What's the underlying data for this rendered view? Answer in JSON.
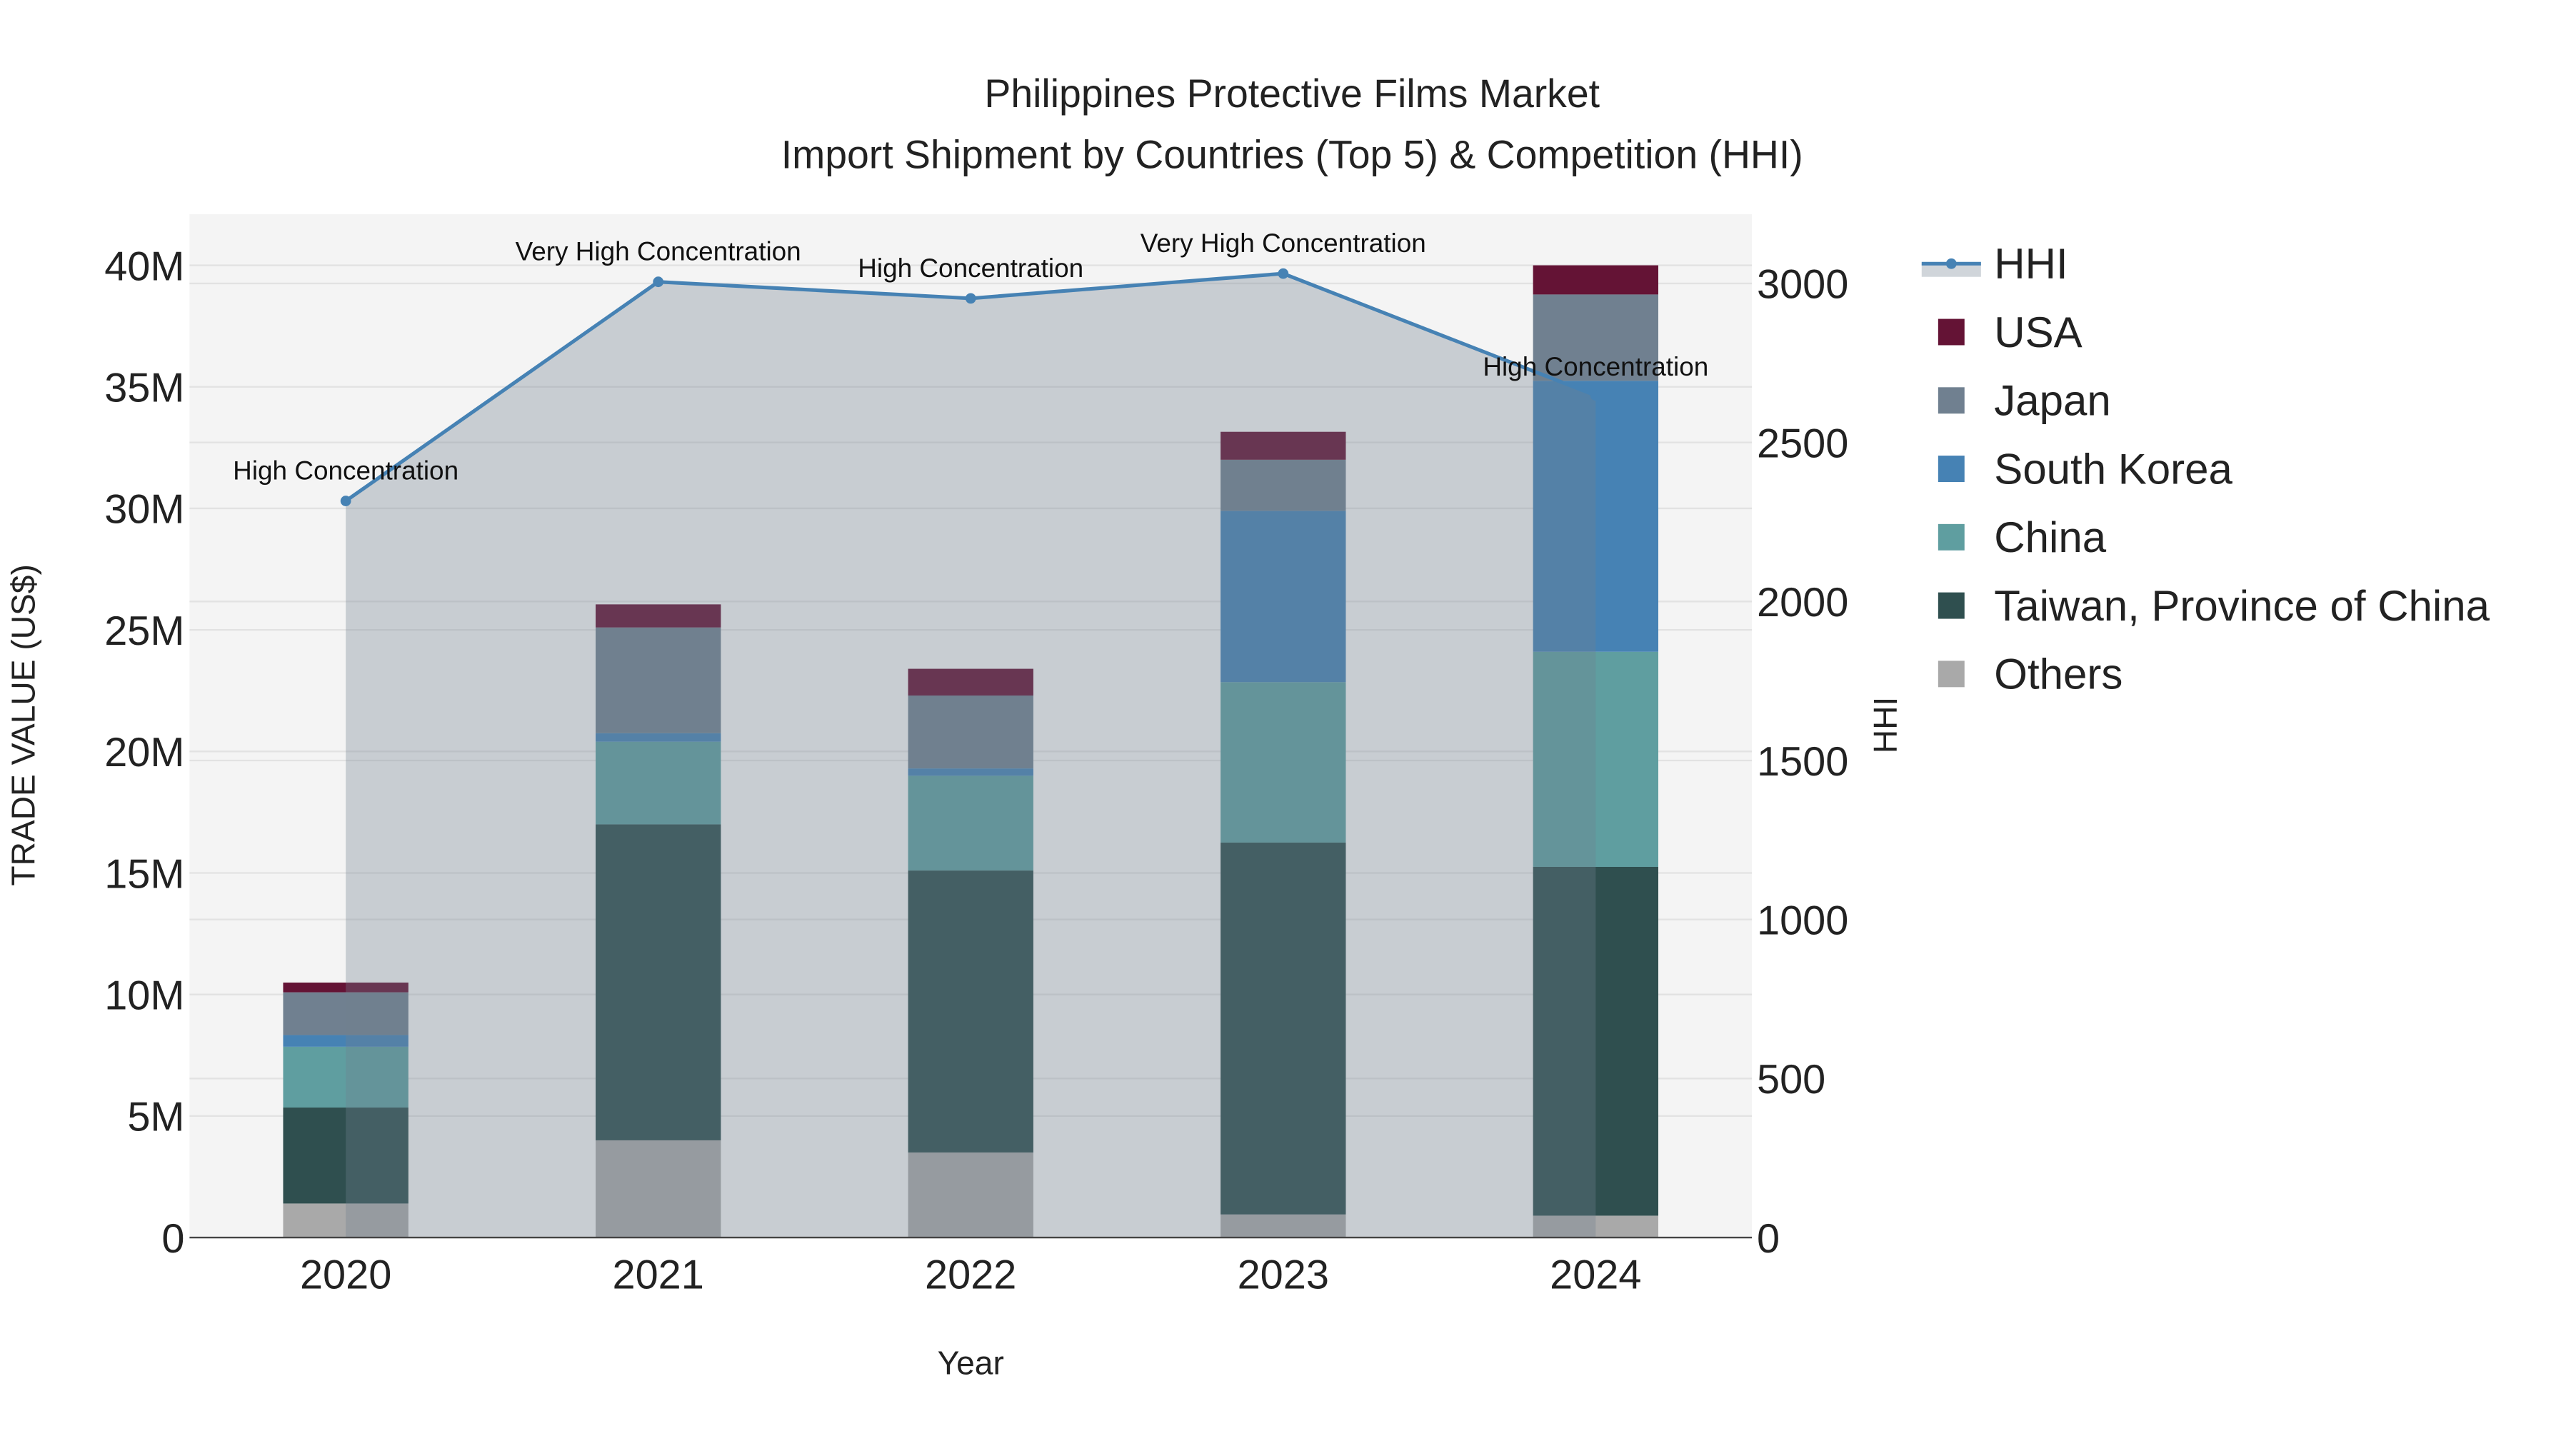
{
  "chart_data": {
    "type": "bar",
    "title": "Philippines Protective Films Market",
    "subtitle": "Import Shipment by Countries (Top 5) & Competition (HHI)",
    "xlabel": "Year",
    "ylabel": "TRADE VALUE (US$)",
    "y2label": "HHI",
    "categories": [
      "2020",
      "2021",
      "2022",
      "2023",
      "2024"
    ],
    "ylim": [
      0,
      42000000
    ],
    "y_ticks": [
      0,
      5000000,
      10000000,
      15000000,
      20000000,
      25000000,
      30000000,
      35000000,
      40000000
    ],
    "y_tick_labels": [
      "0",
      "5M",
      "10M",
      "15M",
      "20M",
      "25M",
      "30M",
      "35M",
      "40M"
    ],
    "y2lim": [
      0,
      3200
    ],
    "y2_ticks": [
      0,
      500,
      1000,
      1500,
      2000,
      2500,
      3000
    ],
    "y2_tick_labels": [
      "0",
      "500",
      "1000",
      "1500",
      "2000",
      "2500",
      "3000"
    ],
    "stacked": true,
    "series": [
      {
        "name": "Others",
        "color": "#a9a9a9",
        "values": [
          1400000,
          4000000,
          3500000,
          950000,
          900000
        ]
      },
      {
        "name": "Taiwan, Province of China",
        "color": "#2f4f4f",
        "values": [
          3950000,
          13000000,
          11600000,
          15300000,
          14350000
        ]
      },
      {
        "name": "China",
        "color": "#5f9ea0",
        "values": [
          2500000,
          3400000,
          3900000,
          6600000,
          8850000
        ]
      },
      {
        "name": "South Korea",
        "color": "#4682b4",
        "values": [
          480000,
          350000,
          300000,
          7050000,
          11150000
        ]
      },
      {
        "name": "Japan",
        "color": "#708090",
        "values": [
          1760000,
          4350000,
          3000000,
          2100000,
          3550000
        ]
      },
      {
        "name": "USA",
        "color": "#641335",
        "values": [
          400000,
          950000,
          1100000,
          1150000,
          1200000
        ]
      }
    ],
    "hhi": {
      "name": "HHI",
      "color": "#4682b4",
      "values": [
        2316,
        3005,
        2953,
        3031,
        2648
      ],
      "annotations": [
        "High Concentration",
        "Very High Concentration",
        "High Concentration",
        "Very High Concentration",
        "High Concentration"
      ]
    },
    "legend_order": [
      "HHI",
      "USA",
      "Japan",
      "South Korea",
      "China",
      "Taiwan, Province of China",
      "Others"
    ],
    "legend_position": "right",
    "grid": true
  }
}
